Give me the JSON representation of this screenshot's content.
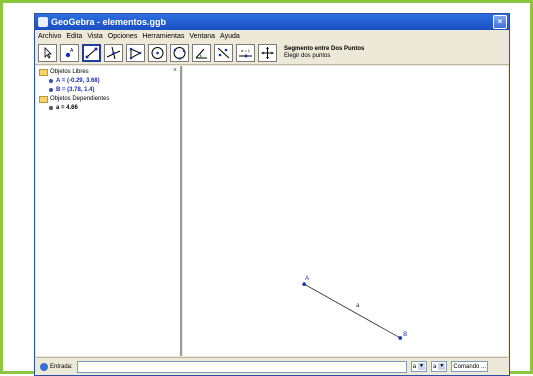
{
  "window": {
    "title": "GeoGebra - elementos.ggb",
    "close": "×"
  },
  "menu": [
    "Archivo",
    "Edita",
    "Vista",
    "Opciones",
    "Herramientas",
    "Ventana",
    "Ayuda"
  ],
  "toolbar": {
    "tooltip_title": "Segmento entre Dos Puntos",
    "tooltip_desc": "Elegir dos puntos",
    "line_label": "a = 1"
  },
  "algebra": {
    "close": "×",
    "free_header": "Objetos Libres",
    "free_items": [
      "A = (-0.29, 3.68)",
      "B = (3.78, 1.4)"
    ],
    "dependent_header": "Objetos Dependientes",
    "dependent_items": [
      "a = 4.66"
    ]
  },
  "canvas": {
    "point_a_label": "A",
    "point_b_label": "B",
    "segment_label": "a",
    "segment": {
      "from": [
        -0.29,
        3.68
      ],
      "to": [
        3.78,
        1.4
      ]
    },
    "colors": {
      "point": "#1a2fb0",
      "segment": "#333333"
    }
  },
  "inputbar": {
    "label": "Entrada:",
    "combo1": "a",
    "combo2": "a",
    "combo3": "Comando ..."
  }
}
